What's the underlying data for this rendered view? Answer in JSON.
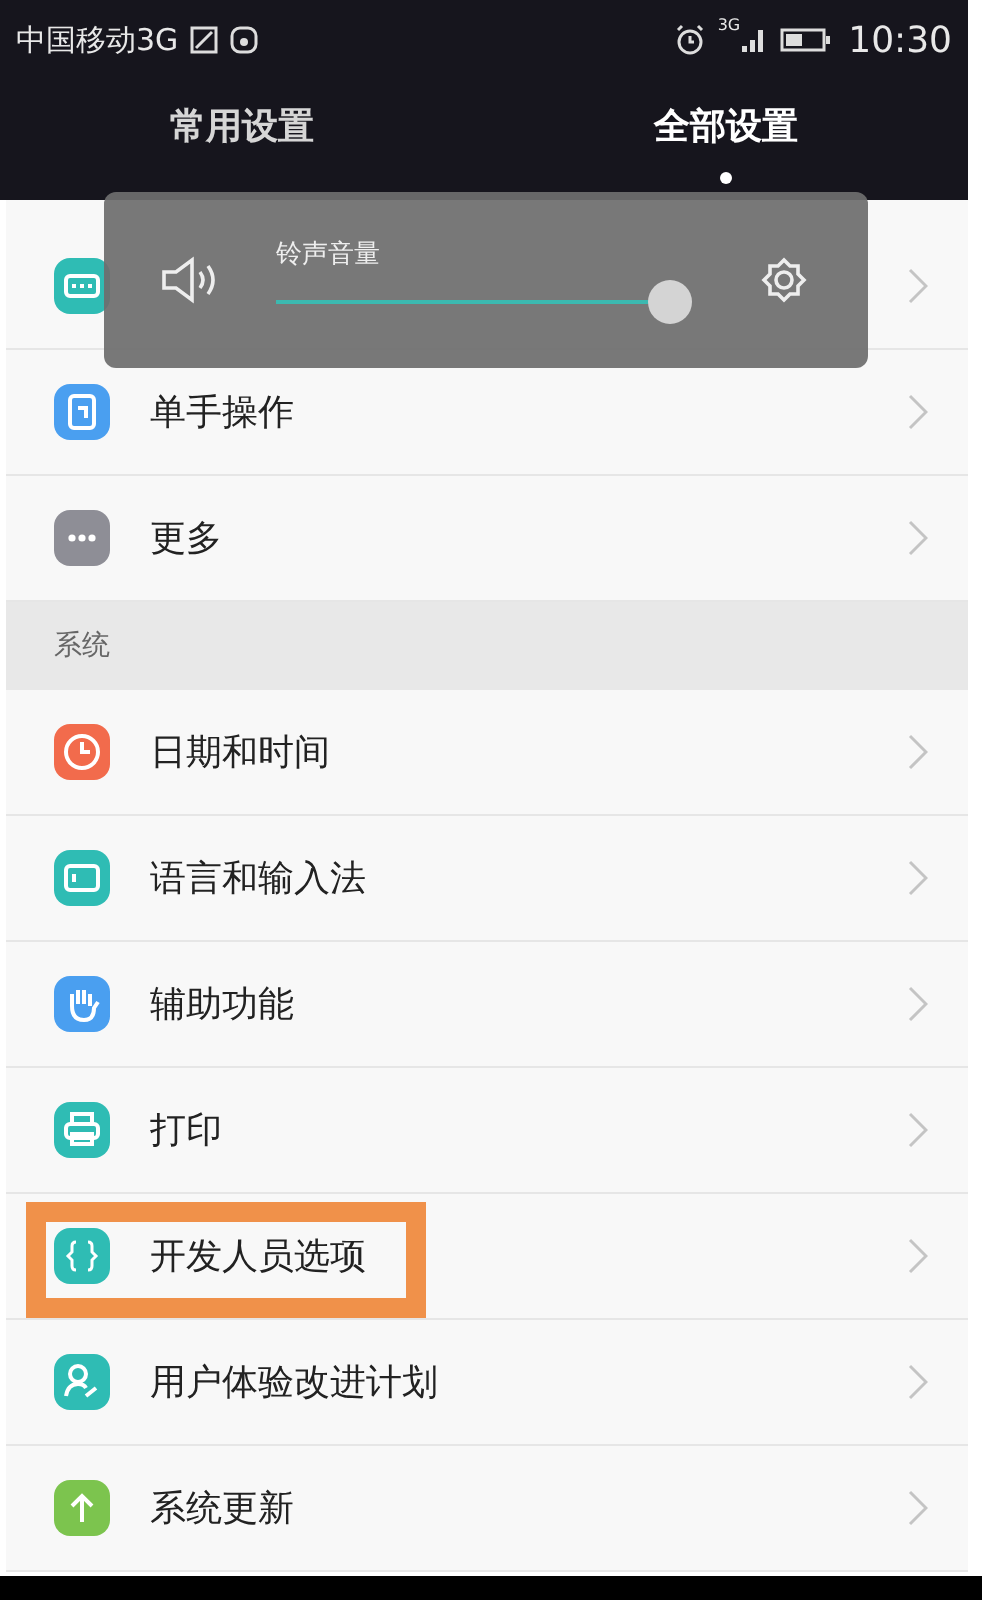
{
  "status_bar": {
    "carrier": "中国移动3G",
    "network": "3G",
    "time": "10:30"
  },
  "tabs": [
    {
      "label": "常用设置",
      "selected": false
    },
    {
      "label": "全部设置",
      "selected": true
    }
  ],
  "volume_popup": {
    "label": "铃声音量",
    "level": 0.97
  },
  "sections": [
    {
      "items": [
        {
          "color": "#2fbcb4",
          "highlighted": false
        },
        {
          "label": "单手操作",
          "color": "#4a9ff0",
          "highlighted": false
        },
        {
          "label": "更多",
          "color": "#8e8e96",
          "highlighted": false
        }
      ]
    },
    {
      "header": "系统",
      "items": [
        {
          "label": "日期和时间",
          "color": "#f26b4c",
          "highlighted": false
        },
        {
          "label": "语言和输入法",
          "color": "#2fbcb4",
          "highlighted": false
        },
        {
          "label": "辅助功能",
          "color": "#4a9ff0",
          "highlighted": false
        },
        {
          "label": "打印",
          "color": "#2fbcb4",
          "highlighted": false
        },
        {
          "label": "开发人员选项",
          "color": "#2fbcb4",
          "highlighted": true
        },
        {
          "label": "用户体验改进计划",
          "color": "#2fbcb4",
          "highlighted": false
        },
        {
          "label": "系统更新",
          "color": "#7cc44e",
          "highlighted": false
        }
      ]
    }
  ]
}
